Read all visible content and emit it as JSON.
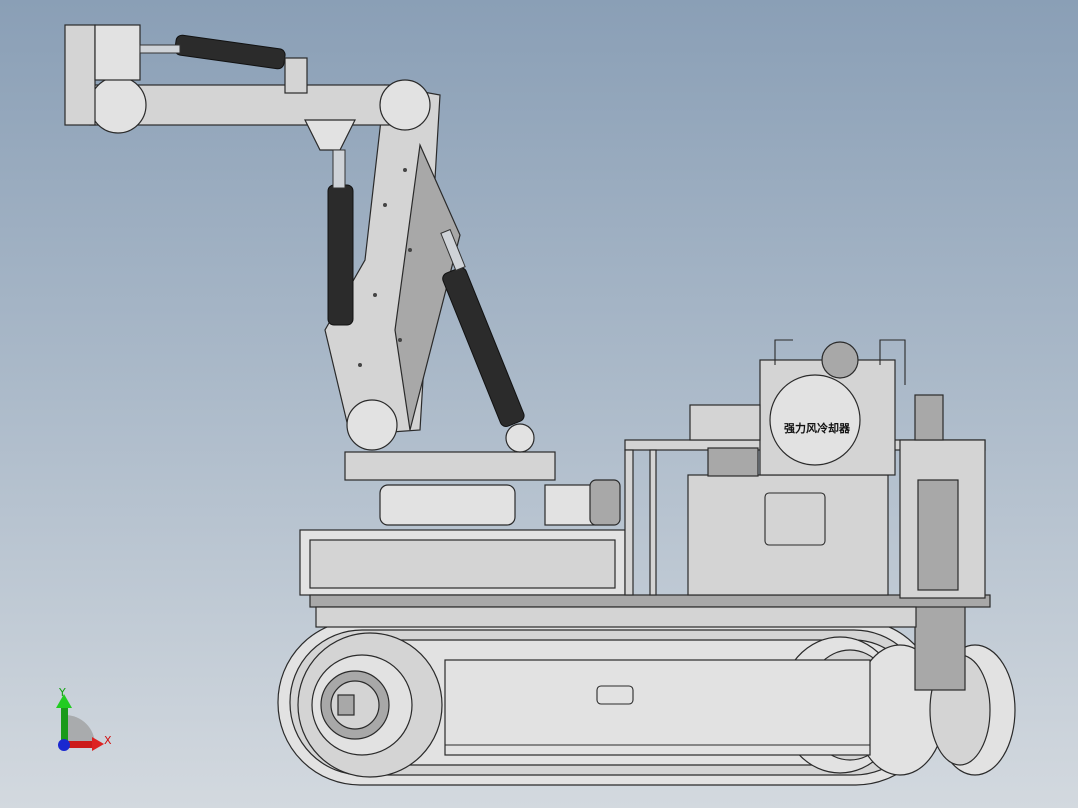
{
  "viewport": {
    "background_top": "#8a9fb6",
    "background_bottom": "#d3d9df"
  },
  "model": {
    "cooler_label": "强力风冷却器"
  },
  "triad": {
    "x_label": "X",
    "y_label": "Y",
    "x_color": "#d01010",
    "y_color": "#10a010",
    "z_color": "#1020c0"
  }
}
